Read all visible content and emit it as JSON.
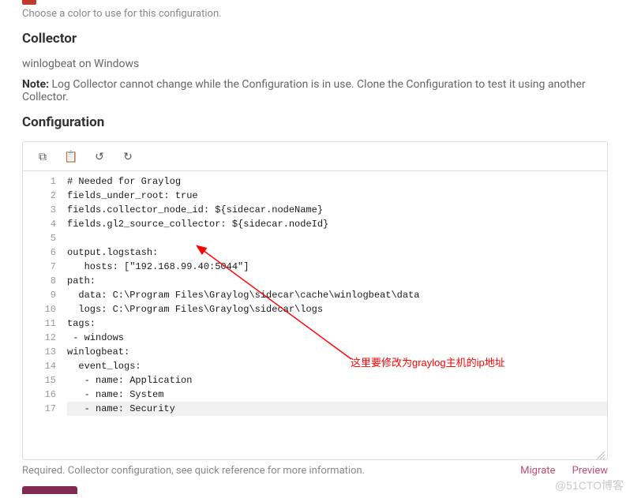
{
  "colorSwatch": "#c0392b",
  "helperColor": "Choose a color to use for this configuration.",
  "collectorHeading": "Collector",
  "collectorValue": "winlogbeat on Windows",
  "noteLabel": "Note:",
  "noteText": "Log Collector cannot change while the Configuration is in use. Clone the Configuration to test it using another Collector.",
  "configHeading": "Configuration",
  "toolbar": {
    "copy": "⧉",
    "paste": "📋",
    "undo": "↺",
    "redo": "↻"
  },
  "lines": [
    "# Needed for Graylog",
    "fields_under_root: true",
    "fields.collector_node_id: ${sidecar.nodeName}",
    "fields.gl2_source_collector: ${sidecar.nodeId}",
    "",
    "output.logstash:",
    "   hosts: [\"192.168.99.40:5044\"]",
    "path:",
    "  data: C:\\Program Files\\Graylog\\sidecar\\cache\\winlogbeat\\data",
    "  logs: C:\\Program Files\\Graylog\\sidecar\\logs",
    "tags:",
    " - windows",
    "winlogbeat:",
    "  event_logs:",
    "   - name: Application",
    "   - name: System",
    "   - name: Security"
  ],
  "selectedLine": 17,
  "requiredText": "Required. Collector configuration, see quick reference for more information.",
  "links": {
    "migrate": "Migrate",
    "preview": "Preview"
  },
  "annotation": "这里要修改为graylog主机的ip地址",
  "watermark": "@51CTO博客"
}
